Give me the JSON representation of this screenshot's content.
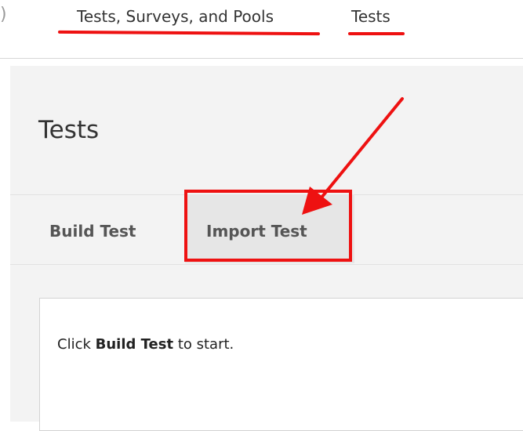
{
  "breadcrumb": {
    "edge_glyph": ")",
    "items": [
      {
        "label": "Tests, Surveys, and Pools"
      },
      {
        "label": "Tests"
      }
    ]
  },
  "page": {
    "title": "Tests"
  },
  "tabs": [
    {
      "label": "Build Test",
      "selected": false
    },
    {
      "label": "Import Test",
      "selected": true
    }
  ],
  "instruction": {
    "prefix": "Click",
    "emphasis": "Build Test",
    "suffix": "to start."
  },
  "colors": {
    "annotation": "#ee1111",
    "content_background": "#f3f3f3",
    "selected_tab_background": "#e6e6e6",
    "text": "#333333"
  }
}
